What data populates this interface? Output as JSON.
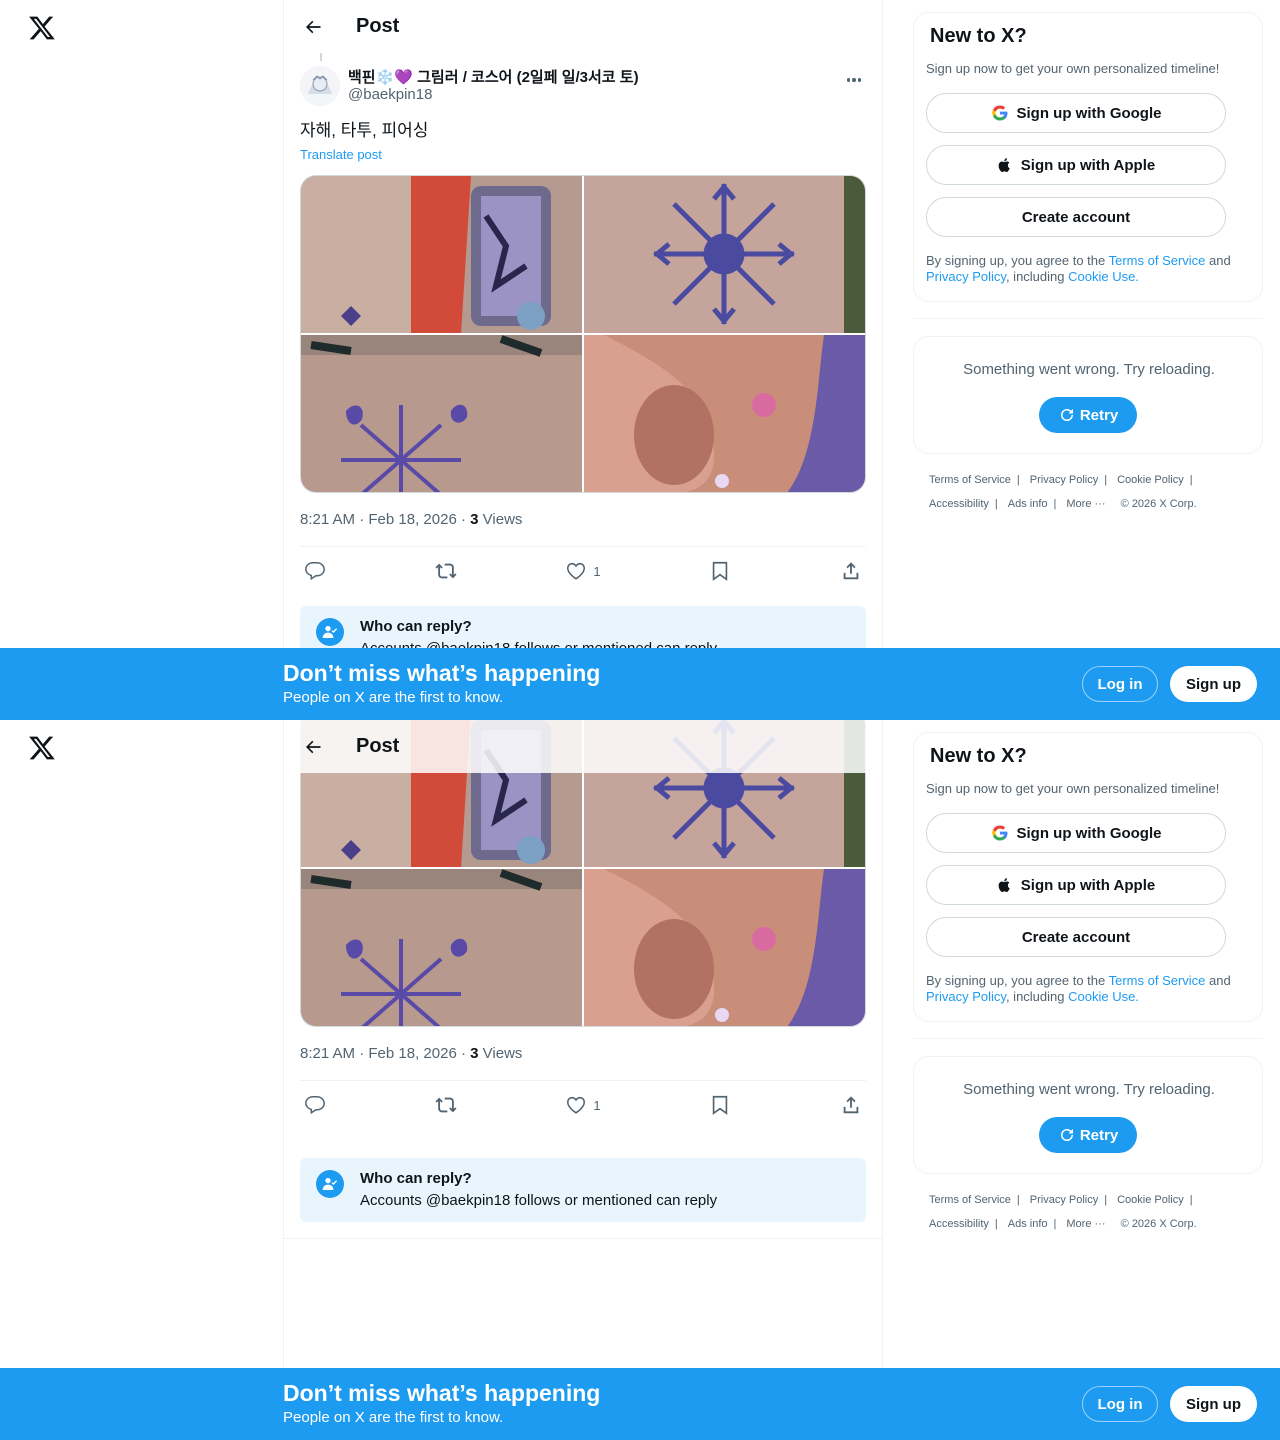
{
  "header": {
    "title": "Post"
  },
  "post": {
    "author_name": "백핀❄️💜 그림러 / 코스어 (2일페 일/3서코 토)",
    "author_handle": "@baekpin18",
    "text": "자해, 타투, 피어싱",
    "translate_label": "Translate post",
    "time": "8:21 AM",
    "date": "Feb 18, 2026",
    "views_count": "3",
    "views_label": "Views",
    "like_count": "1",
    "reply_title": "Who can reply?",
    "reply_text": "Accounts @baekpin18 follows or mentioned can reply"
  },
  "signup_card": {
    "title": "New to X?",
    "subtitle": "Sign up now to get your own personalized timeline!",
    "google_label": "Sign up with Google",
    "apple_label": "Sign up with Apple",
    "create_label": "Create account",
    "terms_prefix": "By signing up, you agree to the ",
    "terms_link": "Terms of Service",
    "terms_and": " and ",
    "privacy_link": "Privacy Policy",
    "including": ", including ",
    "cookie_link": "Cookie Use."
  },
  "error_card": {
    "message": "Something went wrong. Try reloading.",
    "retry_label": "Retry"
  },
  "footer": {
    "terms": "Terms of Service",
    "privacy": "Privacy Policy",
    "cookie": "Cookie Policy",
    "accessibility": "Accessibility",
    "ads": "Ads info",
    "more": "More ···",
    "copyright": "© 2026 X Corp."
  },
  "banner": {
    "title": "Don’t miss what’s happening",
    "subtitle": "People on X are the first to know.",
    "login_label": "Log in",
    "signup_label": "Sign up"
  },
  "colors": {
    "accent": "#1d9bf0",
    "text": "#0f1419",
    "muted": "#536471",
    "reply_bg": "#e8f5fd"
  },
  "icons": [
    "x-logo-icon",
    "back-arrow-icon",
    "more-icon",
    "reply-icon",
    "repost-icon",
    "like-icon",
    "bookmark-icon",
    "share-icon",
    "google-icon",
    "apple-icon",
    "refresh-icon",
    "user-check-icon"
  ]
}
